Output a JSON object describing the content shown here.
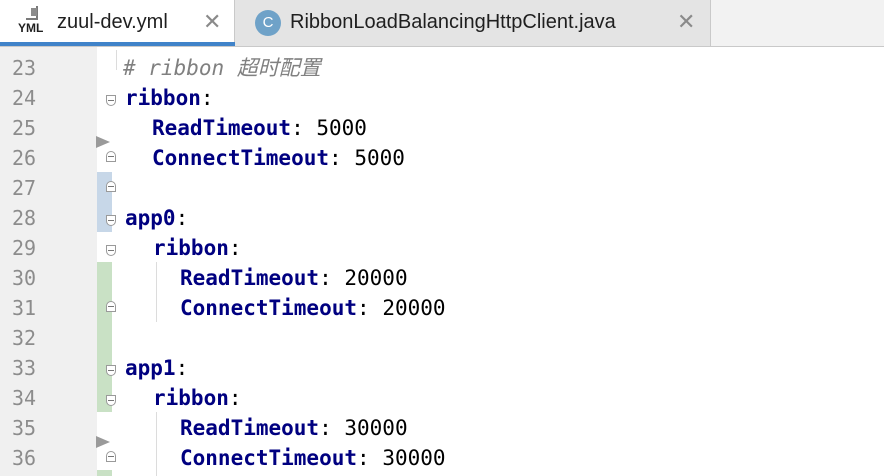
{
  "tabs": [
    {
      "label": "zuul-dev.yml",
      "icon": "yml-file-icon",
      "icon_text": "YML",
      "active": true
    },
    {
      "label": "RibbonLoadBalancingHttpClient.java",
      "icon": "java-class-icon",
      "icon_text": "C",
      "active": false
    }
  ],
  "close_glyph": "✕",
  "lines": [
    {
      "num": "23",
      "comment": "# ribbon 超时配置"
    },
    {
      "num": "24",
      "key": "ribbon",
      "sep": ":",
      "value": ""
    },
    {
      "num": "25",
      "key": "ReadTimeout",
      "sep": ": ",
      "value": "5000"
    },
    {
      "num": "26",
      "key": "ConnectTimeout",
      "sep": ": ",
      "value": "5000"
    },
    {
      "num": "27"
    },
    {
      "num": "28",
      "key": "app0",
      "sep": ":",
      "value": ""
    },
    {
      "num": "29",
      "key": "ribbon",
      "sep": ":",
      "value": ""
    },
    {
      "num": "30",
      "key": "ReadTimeout",
      "sep": ": ",
      "value": "20000"
    },
    {
      "num": "31",
      "key": "ConnectTimeout",
      "sep": ": ",
      "value": "20000"
    },
    {
      "num": "32"
    },
    {
      "num": "33",
      "key": "app1",
      "sep": ":",
      "value": ""
    },
    {
      "num": "34",
      "key": "ribbon",
      "sep": ":",
      "value": ""
    },
    {
      "num": "35",
      "key": "ReadTimeout",
      "sep": ": ",
      "value": "30000"
    },
    {
      "num": "36",
      "key": "ConnectTimeout",
      "sep": ": ",
      "value": "30000"
    }
  ],
  "colors": {
    "key": "#000080",
    "comment": "#808080",
    "modified_marker": "#c7d7e8",
    "added_marker": "#c9e1c5",
    "active_tab_underline": "#4083c9"
  }
}
